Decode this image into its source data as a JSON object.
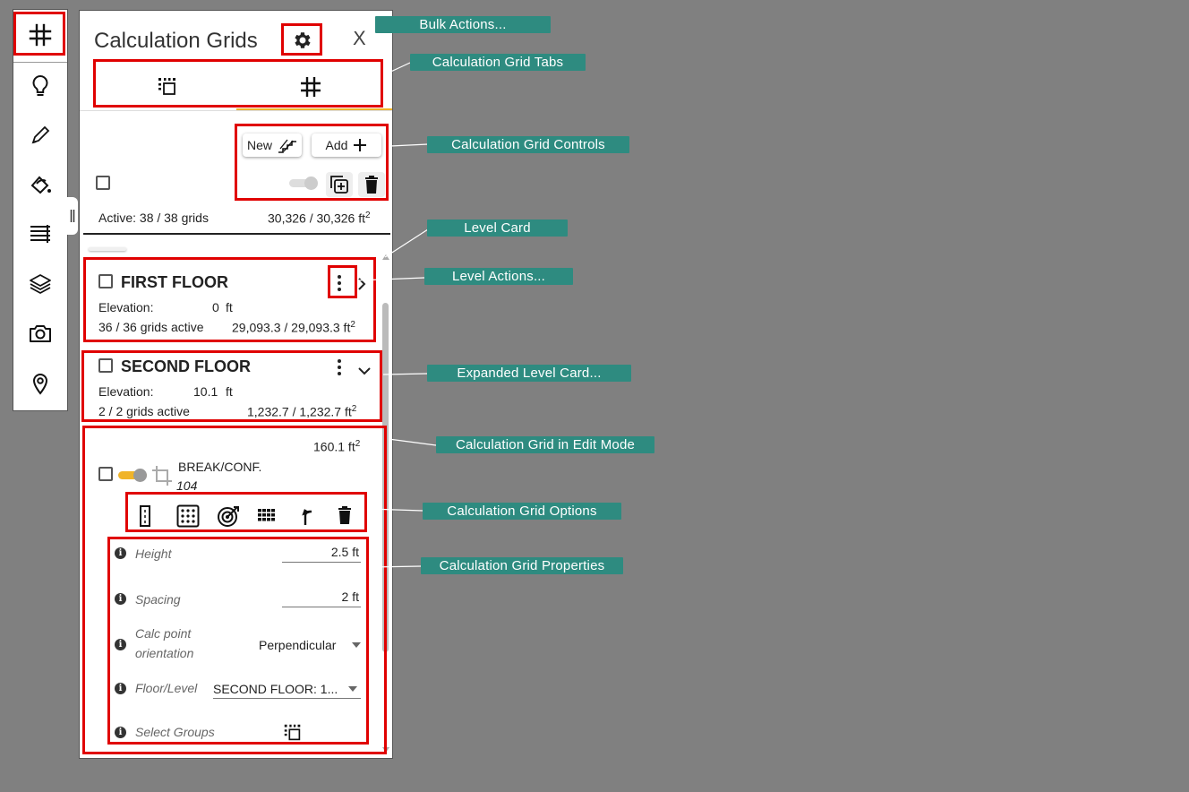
{
  "panel": {
    "title": "Calculation Grids",
    "close_glyph": "X",
    "controls": {
      "new_label": "New",
      "add_label": "Add"
    },
    "summary": {
      "active": "Active: 38 / 38 grids",
      "area": "30,326 / 30,326 ft",
      "area_sup": "2"
    }
  },
  "levels": [
    {
      "name": "FIRST FLOOR",
      "elevation_label": "Elevation:",
      "elevation_value": "0",
      "elevation_unit": "ft",
      "grids_active": "36 / 36 grids active",
      "area": "29,093.3 / 29,093.3 ft",
      "area_sup": "2"
    },
    {
      "name": "SECOND FLOOR",
      "elevation_label": "Elevation:",
      "elevation_value": "10.1",
      "elevation_unit": "ft",
      "grids_active": "2 / 2 grids active",
      "area": "1,232.7 / 1,232.7 ft",
      "area_sup": "2"
    }
  ],
  "grid": {
    "area": "160.1 ft",
    "area_sup": "2",
    "name": "BREAK/CONF.",
    "number": "104",
    "props": {
      "height_label": "Height",
      "height_value": "2.5 ft",
      "spacing_label": "Spacing",
      "spacing_value": "2 ft",
      "orientation_label_1": "Calc point",
      "orientation_label_2": "orientation",
      "orientation_value": "Perpendicular",
      "floor_label": "Floor/Level",
      "floor_value": "SECOND FLOOR: 1...",
      "groups_label": "Select Groups"
    }
  },
  "callouts": {
    "bulk_actions": "Bulk Actions...",
    "grid_tabs": "Calculation Grid Tabs",
    "grid_controls": "Calculation Grid Controls",
    "level_card": "Level Card",
    "level_actions": "Level Actions...",
    "expanded_level_card": "Expanded Level Card...",
    "grid_edit_mode": "Calculation Grid in Edit Mode",
    "grid_options": "Calculation Grid Options",
    "grid_properties": "Calculation Grid Properties"
  },
  "colors": {
    "highlight": "#e00000",
    "callout": "#2e8b80",
    "toggle_on": "#f0b429",
    "tab_indicator": "#f0b429"
  }
}
